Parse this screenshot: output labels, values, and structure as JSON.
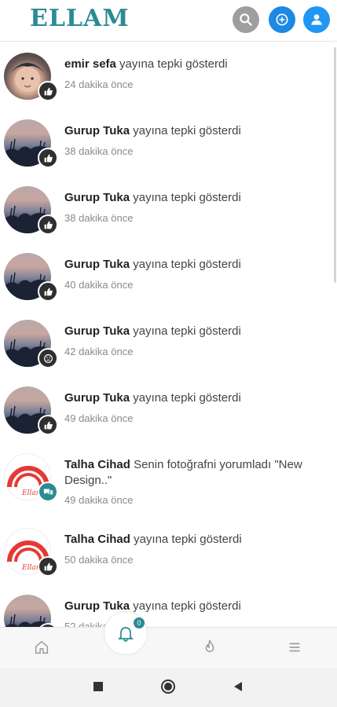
{
  "app": {
    "logo": "ELLAM"
  },
  "header": {
    "search_icon": "search-icon",
    "add_icon": "plus-circle-icon",
    "profile_icon": "person-icon"
  },
  "notifications": [
    {
      "name": "emir sefa",
      "action": "yayına tepki gösterdi",
      "time": "24 dakika önce",
      "avatar": "emir",
      "badge": "like-icon"
    },
    {
      "name": "Gurup Tuka",
      "action": "yayına tepki gösterdi",
      "time": "38 dakika önce",
      "avatar": "tuka",
      "badge": "like-icon"
    },
    {
      "name": "Gurup Tuka",
      "action": "yayına tepki gösterdi",
      "time": "38 dakika önce",
      "avatar": "tuka",
      "badge": "like-icon"
    },
    {
      "name": "Gurup Tuka",
      "action": "yayına tepki gösterdi",
      "time": "40 dakika önce",
      "avatar": "tuka",
      "badge": "like-icon"
    },
    {
      "name": "Gurup Tuka",
      "action": "yayına tepki gösterdi",
      "time": "42 dakika önce",
      "avatar": "tuka",
      "badge": "sad-face-icon"
    },
    {
      "name": "Gurup Tuka",
      "action": "yayına tepki gösterdi",
      "time": "49 dakika önce",
      "avatar": "tuka",
      "badge": "like-icon"
    },
    {
      "name": "Talha Cihad",
      "action": "Senin fotoğrafni yorumladı \"New Design..\"",
      "time": "49 dakika önce",
      "avatar": "talha",
      "badge": "comment-icon"
    },
    {
      "name": "Talha Cihad",
      "action": "yayına tepki gösterdi",
      "time": "50 dakika önce",
      "avatar": "talha",
      "badge": "like-icon"
    },
    {
      "name": "Gurup Tuka",
      "action": "yayına tepki gösterdi",
      "time": "52 dakika önce",
      "avatar": "tuka",
      "badge": "like-icon"
    }
  ],
  "bottom_nav": {
    "home_icon": "home-icon",
    "bell_icon": "bell-icon",
    "bell_count": "0",
    "fire_icon": "fire-icon",
    "menu_icon": "menu-icon"
  },
  "colors": {
    "brand": "#2a8b93",
    "blue": "#1e88e5"
  }
}
